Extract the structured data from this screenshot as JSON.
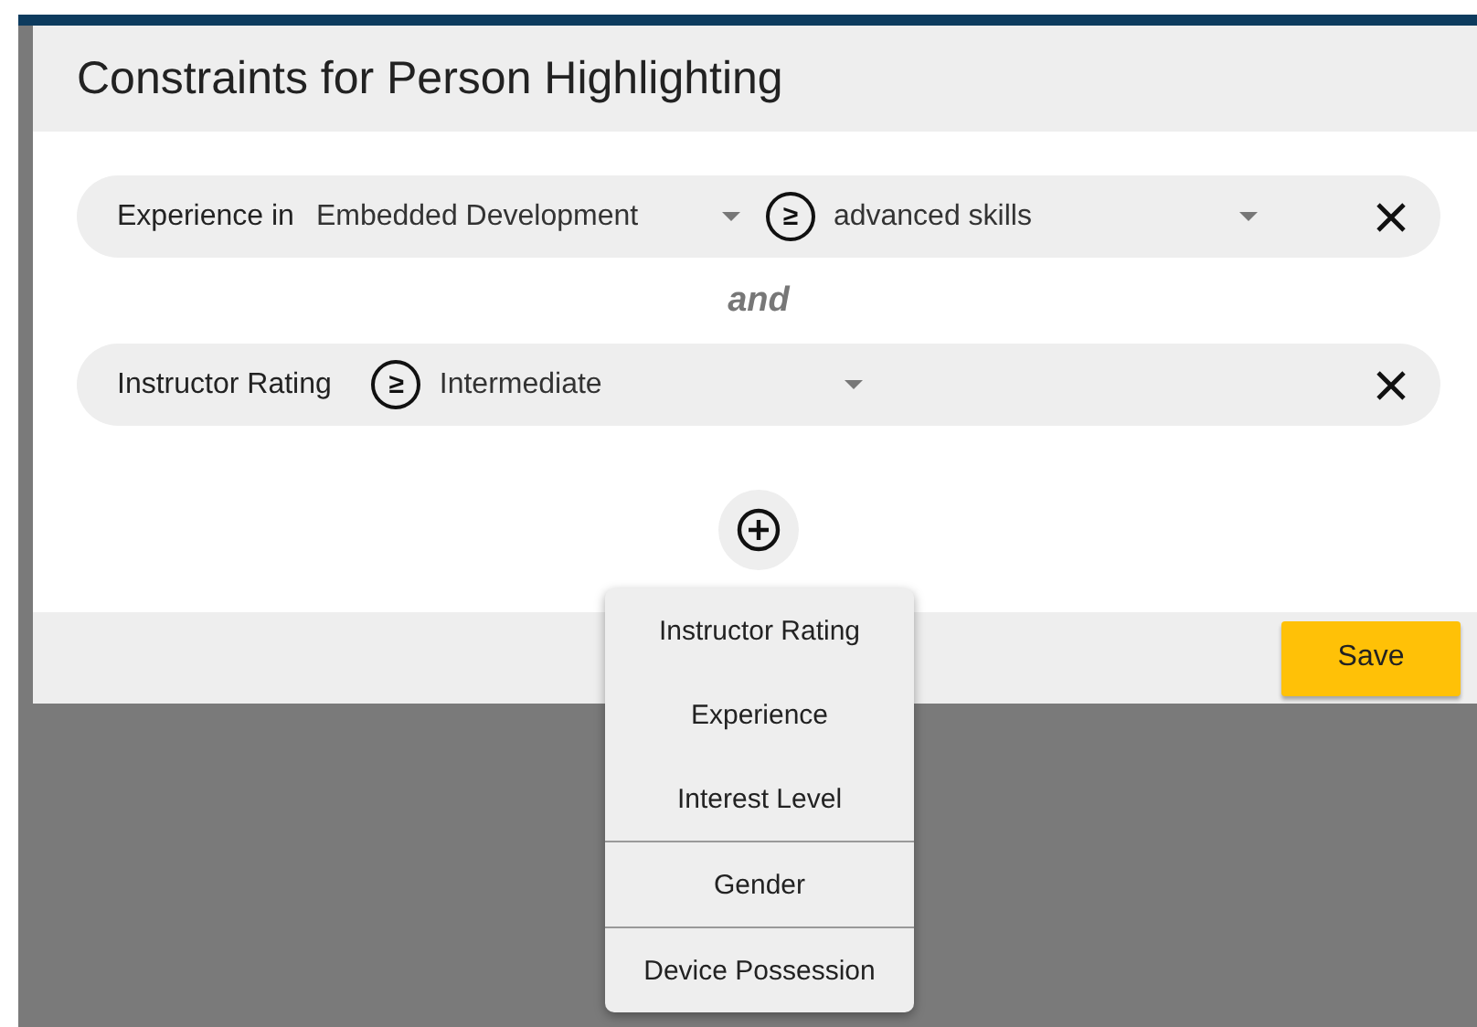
{
  "dialog": {
    "title": "Constraints for Person Highlighting"
  },
  "constraints": [
    {
      "label": "Experience in",
      "subject": "Embedded Development",
      "operator": "≥",
      "value": "advanced skills"
    },
    {
      "label": "Instructor Rating",
      "operator": "≥",
      "value": "Intermediate"
    }
  ],
  "conjunction": "and",
  "save_button": "Save",
  "add_menu": {
    "groups": [
      {
        "items": [
          "Instructor Rating",
          "Experience",
          "Interest Level"
        ]
      },
      {
        "items": [
          "Gender"
        ]
      },
      {
        "items": [
          "Device Possession"
        ]
      }
    ]
  }
}
